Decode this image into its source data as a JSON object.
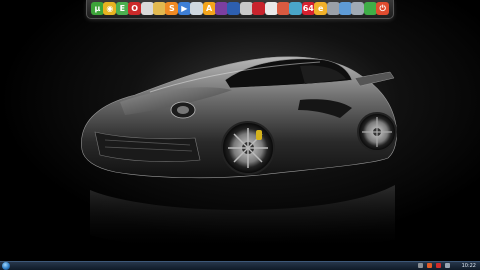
{
  "desktop": {
    "wallpaper": "black sports car on dark background"
  },
  "dock": {
    "items": [
      {
        "name": "utorrent-icon",
        "color": "#3da43a",
        "glyph": "µ"
      },
      {
        "name": "chrome-icon",
        "color": "#e8b321",
        "glyph": "◉"
      },
      {
        "name": "evernote-icon",
        "color": "#4caf50",
        "glyph": "E"
      },
      {
        "name": "opera-icon",
        "color": "#cc2a2a",
        "glyph": "O"
      },
      {
        "name": "file-icon",
        "color": "#d9d9d9",
        "glyph": ""
      },
      {
        "name": "folder-icon",
        "color": "#e2b950",
        "glyph": ""
      },
      {
        "name": "skype-icon",
        "color": "#f08a24",
        "glyph": "S"
      },
      {
        "name": "media-player-icon",
        "color": "#3e7fd6",
        "glyph": "▶"
      },
      {
        "name": "notepad-icon",
        "color": "#cfd8e0",
        "glyph": ""
      },
      {
        "name": "avast-icon",
        "color": "#f3a51c",
        "glyph": "A"
      },
      {
        "name": "rar-icon",
        "color": "#7c3fa0",
        "glyph": ""
      },
      {
        "name": "save-icon",
        "color": "#2d5fb0",
        "glyph": ""
      },
      {
        "name": "bug-icon",
        "color": "#c9c9c9",
        "glyph": ""
      },
      {
        "name": "red-app-icon",
        "color": "#c8232d",
        "glyph": ""
      },
      {
        "name": "vlc-icon",
        "color": "#e9e9e9",
        "glyph": ""
      },
      {
        "name": "cd-icon",
        "color": "#d95a40",
        "glyph": ""
      },
      {
        "name": "network-icon",
        "color": "#4aa6c9",
        "glyph": ""
      },
      {
        "name": "64-icon",
        "color": "#d6202f",
        "glyph": "64"
      },
      {
        "name": "ie-icon",
        "color": "#f0b02a",
        "glyph": "e"
      },
      {
        "name": "chart-icon",
        "color": "#9aa0a8",
        "glyph": ""
      },
      {
        "name": "document-icon",
        "color": "#5e9bd6",
        "glyph": ""
      },
      {
        "name": "tablet-icon",
        "color": "#a0aab4",
        "glyph": ""
      },
      {
        "name": "game-icon",
        "color": "#3fae47",
        "glyph": ""
      },
      {
        "name": "power-icon",
        "color": "#e04c2f",
        "glyph": "⏻"
      }
    ]
  },
  "taskbar": {
    "tray": [
      {
        "name": "tray-flag-icon",
        "color": "#8a8f95"
      },
      {
        "name": "tray-antivirus-icon",
        "color": "#e35b25"
      },
      {
        "name": "tray-volume-icon",
        "color": "#cf2b2b"
      },
      {
        "name": "tray-network-icon",
        "color": "#9aa6b4"
      }
    ],
    "clock": "10:22"
  }
}
